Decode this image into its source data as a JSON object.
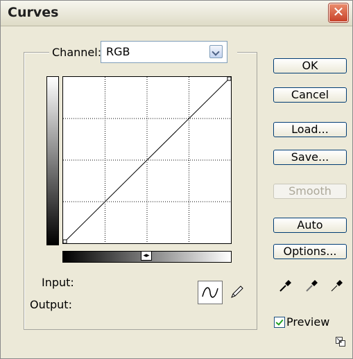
{
  "window": {
    "title": "Curves",
    "close_glyph": "✕"
  },
  "channel": {
    "label": "Channel:",
    "value": "RGB"
  },
  "curve": {
    "grid_divisions": 4,
    "points": [
      [
        0,
        0
      ],
      [
        255,
        255
      ]
    ]
  },
  "labels": {
    "input": "Input:",
    "output": "Output:"
  },
  "slider": {
    "handle_glyph": "◂▸"
  },
  "buttons": {
    "ok": "OK",
    "cancel": "Cancel",
    "load": "Load...",
    "save": "Save...",
    "smooth": "Smooth",
    "auto": "Auto",
    "options": "Options..."
  },
  "preview": {
    "label": "Preview",
    "checked": true
  },
  "icons": {
    "curve_tool": "curve-tool-icon",
    "pencil_tool": "pencil-icon",
    "eyedroppers": [
      "black-eyedropper-icon",
      "gray-eyedropper-icon",
      "white-eyedropper-icon"
    ],
    "resize": "expand-icon"
  },
  "colors": {
    "face": "#ece9d8",
    "close": "#c8432a",
    "check": "#21a121"
  }
}
